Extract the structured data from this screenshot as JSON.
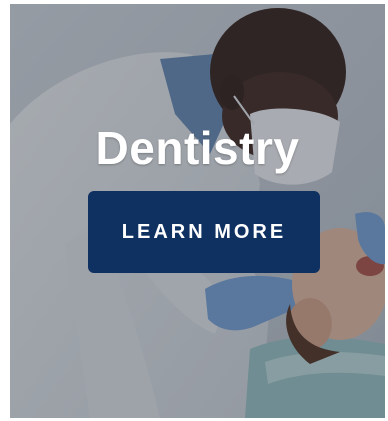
{
  "card": {
    "title": "Dentistry",
    "button_label": "LEARN MORE",
    "button_color": "#0f3161",
    "photo_subject": "dentist-with-patient-photo"
  }
}
